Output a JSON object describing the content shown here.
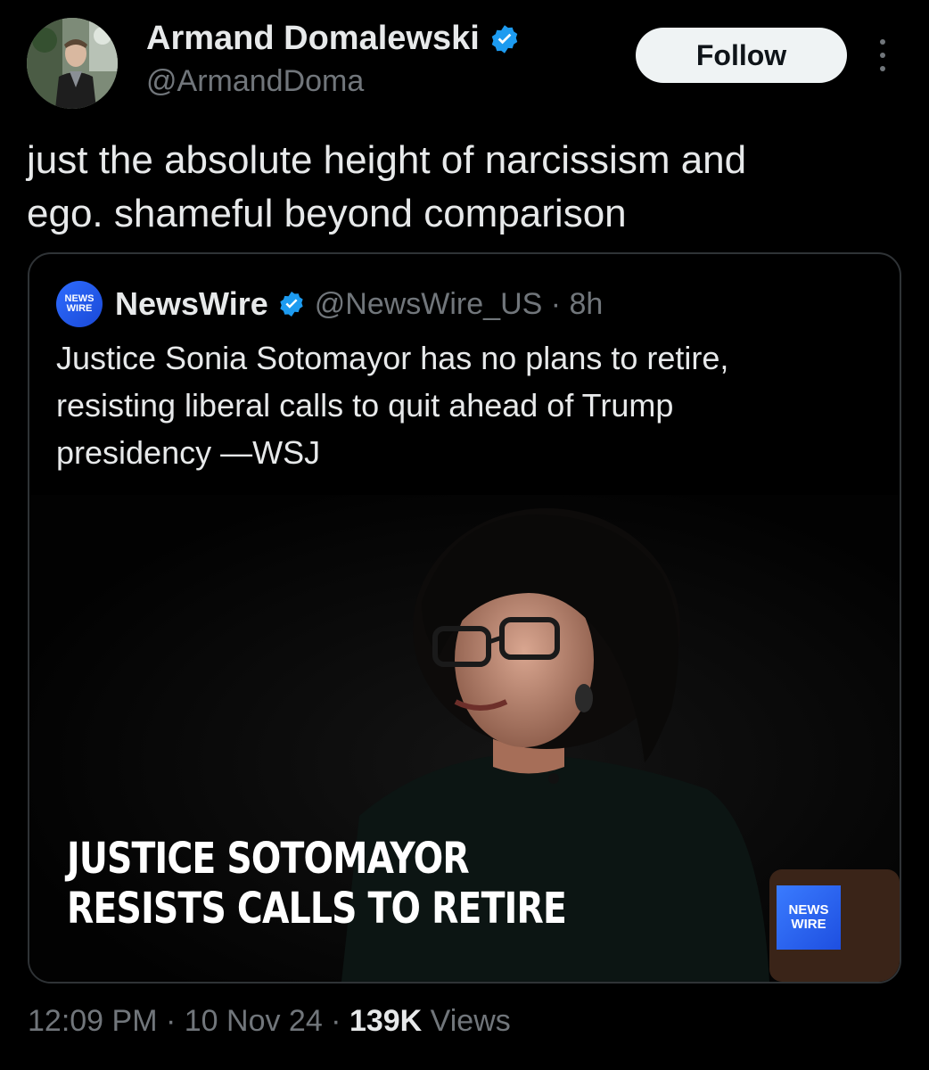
{
  "author": {
    "name": "Armand Domalewski",
    "handle": "@ArmandDoma",
    "verified": true
  },
  "follow_label": "Follow",
  "more_icon": "more-vertical-icon",
  "tweet": {
    "line1": "just the absolute height of narcissism and",
    "line2": "ego. shameful beyond comparison"
  },
  "quote": {
    "logo_line1": "NEWS",
    "logo_line2": "WIRE",
    "name": "NewsWire",
    "handle_time": "@NewsWire_US · 8h",
    "line1": "Justice Sonia Sotomayor has no plans to retire,",
    "line2": "resisting liberal calls to quit ahead of Trump",
    "line3": "presidency —WSJ",
    "media": {
      "headline_line1": "JUSTICE SOTOMAYOR",
      "headline_line2": "RESISTS CALLS TO RETIRE",
      "logo_line1": "NEWS",
      "logo_line2": "WIRE"
    }
  },
  "footer": {
    "time_date": "12:09 PM · 10 Nov 24 · ",
    "views_count": "139K",
    "views_label": " Views"
  },
  "colors": {
    "background": "#000000",
    "text": "#e7e9ea",
    "muted": "#71767b",
    "verified": "#1d9bf0",
    "brand": "#2e6cff"
  }
}
